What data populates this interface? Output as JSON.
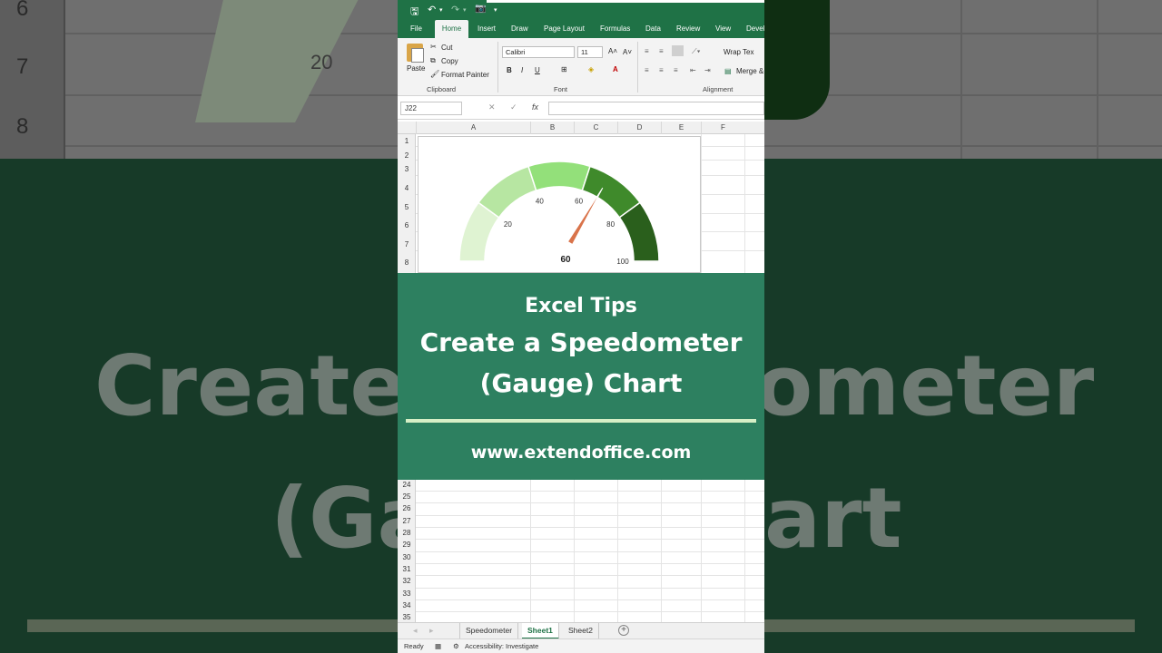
{
  "background": {
    "row_numbers": [
      "6",
      "7",
      "8"
    ],
    "label_20": "20",
    "big_text_line1_left": "Create",
    "big_text_line1_right": "ometer",
    "big_text_line2_left": "(Ga",
    "big_text_line2_right": "art"
  },
  "quick_access": {
    "save": "🖫",
    "undo": "↶",
    "redo": "↷",
    "camera": "📷",
    "more": "▾"
  },
  "tabs": [
    "File",
    "Home",
    "Insert",
    "Draw",
    "Page Layout",
    "Formulas",
    "Data",
    "Review",
    "View",
    "Devel"
  ],
  "active_tab": "Home",
  "ribbon": {
    "paste": "Paste",
    "cut": "Cut",
    "copy": "Copy",
    "format_painter": "Format Painter",
    "clipboard_group": "Clipboard",
    "font_name": "Calibri",
    "font_size": "11",
    "bold": "B",
    "italic": "I",
    "underline": "U",
    "font_group": "Font",
    "wrap_text": "Wrap Tex",
    "merge": "Merge &",
    "alignment_group": "Alignment"
  },
  "formula_bar": {
    "name_box": "J22",
    "cancel": "✕",
    "enter": "✓",
    "fx": "fx",
    "value": ""
  },
  "columns": [
    "A",
    "B",
    "C",
    "D",
    "E",
    "F"
  ],
  "rows_top": [
    "1",
    "2",
    "3",
    "4",
    "5",
    "6",
    "7",
    "8"
  ],
  "rows_bottom": [
    "24",
    "25",
    "26",
    "27",
    "28",
    "29",
    "30",
    "31",
    "32",
    "33",
    "34",
    "35"
  ],
  "chart_data": {
    "type": "gauge",
    "value": 60,
    "value_label": "60",
    "min": 0,
    "max": 100,
    "tick_labels": [
      "20",
      "40",
      "60",
      "80",
      "100"
    ],
    "bands": [
      {
        "from": 0,
        "to": 20,
        "color": "#dff3d2"
      },
      {
        "from": 20,
        "to": 40,
        "color": "#b7e6a2"
      },
      {
        "from": 40,
        "to": 60,
        "color": "#93e07a"
      },
      {
        "from": 60,
        "to": 80,
        "color": "#3f8a2b"
      },
      {
        "from": 80,
        "to": 100,
        "color": "#2a5f1c"
      }
    ],
    "needle_color": "#d9734a"
  },
  "banner": {
    "tag": "Excel Tips",
    "title_line1": "Create a Speedometer",
    "title_line2": "(Gauge) Chart",
    "url": "www.extendoffice.com"
  },
  "sheets": [
    "Speedometer",
    "Sheet1",
    "Sheet2"
  ],
  "active_sheet": "Sheet1",
  "status": {
    "ready": "Ready",
    "accessibility": "Accessibility: Investigate"
  },
  "colors": {
    "excel_green": "#1f7246",
    "banner_green": "#2d8060",
    "rule_light": "#d6efc6"
  }
}
